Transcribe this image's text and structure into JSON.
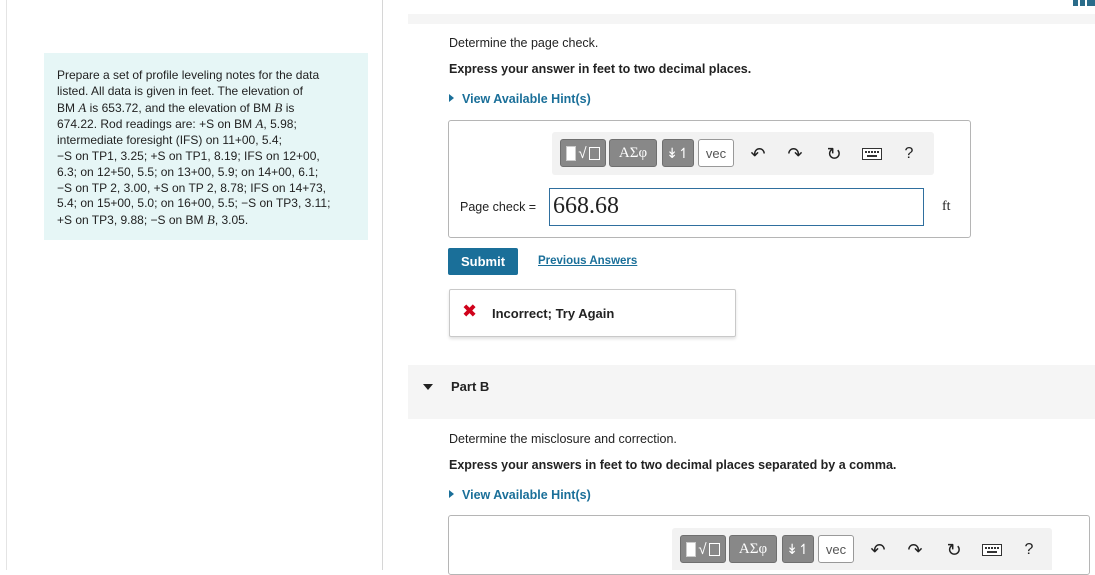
{
  "problem": {
    "line1": "Prepare a set of profile leveling notes for the data",
    "line2": "listed. All data is given in feet. The elevation of",
    "line3_pre": "BM ",
    "bm_a": "A",
    "line3_mid": " is 653.72, and the elevation of BM ",
    "bm_b": "B",
    "line3_post": " is",
    "line4_pre": "674.22. Rod readings are: +S on BM ",
    "line4_post": ", 5.98;",
    "line5": "intermediate foresight (IFS) on 11+00, 5.4;",
    "line6": "−S on TP1, 3.25; +S on TP1, 8.19; IFS on 12+00,",
    "line7": "6.3; on 12+50, 5.5; on 13+00, 5.9; on 14+00, 6.1;",
    "line8": "−S on TP 2, 3.00, +S on TP 2, 8.78; IFS on 14+73,",
    "line9": "5.4; on 15+00, 5.0; on 16+00, 5.5; −S on TP3, 3.11;",
    "line10_pre": "+S on TP3, 9.88; −S on BM ",
    "line10_post": ", 3.05."
  },
  "part_a": {
    "question": "Determine the page check.",
    "instruction": "Express your answer in feet to two decimal places.",
    "hint_link": "View Available Hint(s)",
    "input_label": "Page check =",
    "input_value": "668.68",
    "unit": "ft",
    "submit_label": "Submit",
    "previous_answers_label": "Previous Answers",
    "feedback": "Incorrect; Try Again",
    "feedback_icon": "✖"
  },
  "toolbar": {
    "greek_label": "ΑΣφ",
    "arrows_label": "↡↿",
    "vec_label": "vec",
    "help_label": "?"
  },
  "part_b": {
    "title": "Part B",
    "question": "Determine the misclosure and correction.",
    "instruction": "Express your answers in feet to two decimal places separated by a comma.",
    "hint_link": "View Available Hint(s)"
  },
  "colors": {
    "link": "#1a6f99",
    "error": "#d0021b",
    "problem_bg": "#e6f6f6"
  }
}
